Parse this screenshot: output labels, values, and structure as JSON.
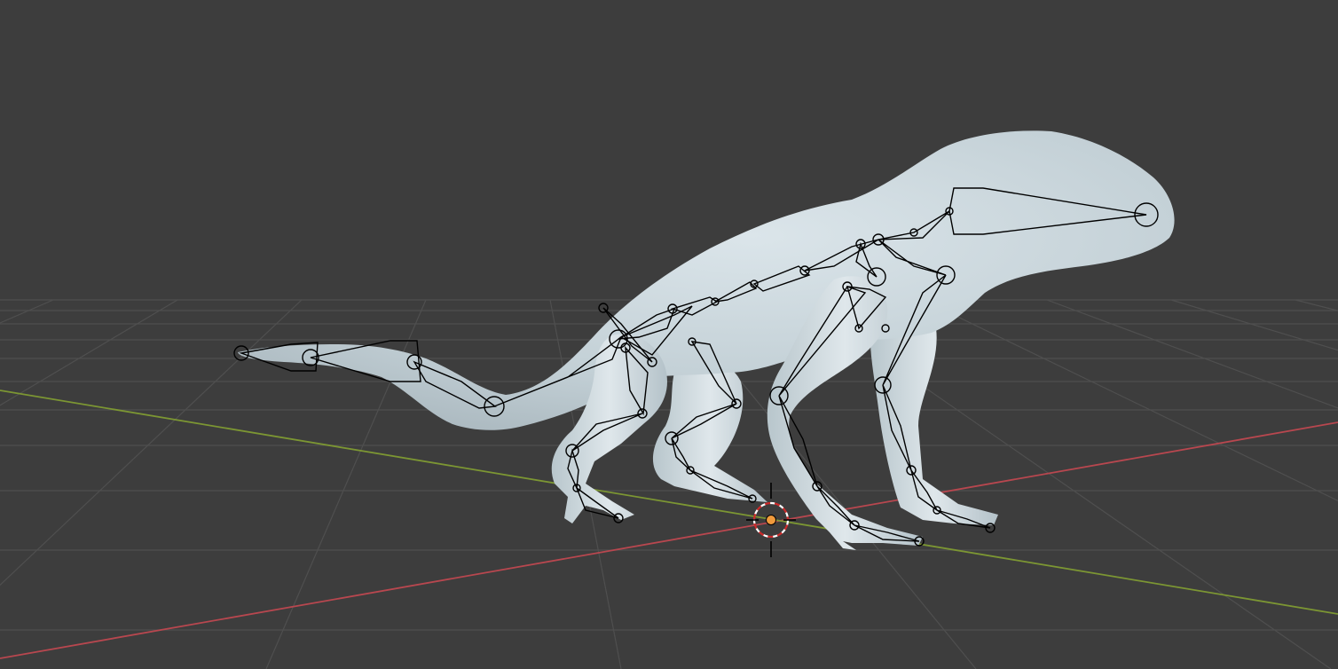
{
  "viewport": {
    "mode": "3D viewport",
    "shading": "solid",
    "background_color": "#3d3d3d"
  },
  "scene": {
    "grid_color": "#4f4f4f",
    "x_axis_color": "#b8474f",
    "y_axis_color": "#7c9633",
    "mesh_color": "#c5d3d9",
    "armature_color": "#000000",
    "cursor_fill_color": "#f09a3c",
    "icons": [
      "3d-cursor-icon"
    ]
  }
}
